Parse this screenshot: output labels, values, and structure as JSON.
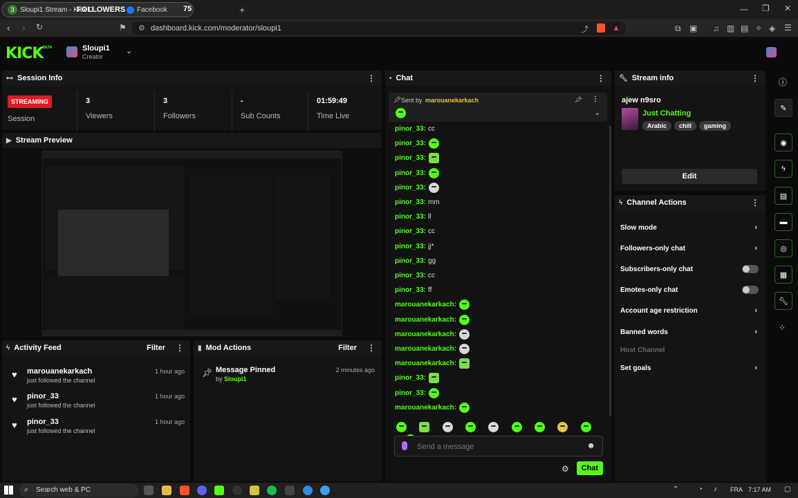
{
  "browser": {
    "tab_counter": "3",
    "tab_title": "Sloupi1 Stream - Kick D...",
    "overlay_followers": "FOLLOWERS",
    "overlay_facebook": "Facebook",
    "overlay_count": "75",
    "url": "dashboard.kick.com/moderator/sloupi1"
  },
  "header": {
    "logo": "KICK",
    "beta": "BETA",
    "channel_name": "Sloupi1",
    "channel_role": "Creator"
  },
  "session_info": {
    "title": "Session Info",
    "streaming_badge": "STREAMING",
    "session_label": "Session",
    "stats": [
      {
        "value": "3",
        "label": "Viewers"
      },
      {
        "value": "3",
        "label": "Followers"
      },
      {
        "value": "-",
        "label": "Sub Counts"
      },
      {
        "value": "01:59:49",
        "label": "Time Live"
      }
    ]
  },
  "stream_preview": {
    "title": "Stream Preview"
  },
  "activity_feed": {
    "title": "Activity Feed",
    "filter": "Filter",
    "items": [
      {
        "name": "marouanekarkach",
        "action": "just followed the channel",
        "time": "1 hour ago"
      },
      {
        "name": "pinor_33",
        "action": "just followed the channel",
        "time": "1 hour ago"
      },
      {
        "name": "pinor_33",
        "action": "just followed the channel",
        "time": "1 hour ago"
      }
    ]
  },
  "mod_actions": {
    "title": "Mod Actions",
    "filter": "Filter",
    "items": [
      {
        "title": "Message Pinned",
        "by_prefix": "by",
        "by_user": "Sloupi1",
        "time": "2 minutes ago"
      }
    ]
  },
  "chat": {
    "title": "Chat",
    "pinned_prefix": "Sent by",
    "pinned_user": "marouanekarkach",
    "messages": [
      {
        "user": "pinor_33:",
        "text": "cc",
        "emote": ""
      },
      {
        "user": "pinor_33:",
        "text": "",
        "emote": "green"
      },
      {
        "user": "pinor_33:",
        "text": "",
        "emote": "box"
      },
      {
        "user": "pinor_33:",
        "text": "",
        "emote": "green"
      },
      {
        "user": "pinor_33:",
        "text": "",
        "emote": "robot"
      },
      {
        "user": "pinor_33:",
        "text": "mm",
        "emote": ""
      },
      {
        "user": "pinor_33:",
        "text": "ll",
        "emote": ""
      },
      {
        "user": "pinor_33:",
        "text": "cc",
        "emote": ""
      },
      {
        "user": "pinor_33:",
        "text": "jj*",
        "emote": ""
      },
      {
        "user": "pinor_33:",
        "text": "gg",
        "emote": ""
      },
      {
        "user": "pinor_33:",
        "text": "cc",
        "emote": ""
      },
      {
        "user": "pinor_33:",
        "text": "ff",
        "emote": ""
      },
      {
        "user": "marouanekarkach:",
        "text": "",
        "emote": "green"
      },
      {
        "user": "marouanekarkach:",
        "text": "",
        "emote": "green"
      },
      {
        "user": "marouanekarkach:",
        "text": "",
        "emote": "robot"
      },
      {
        "user": "marouanekarkach:",
        "text": "",
        "emote": "robot"
      },
      {
        "user": "marouanekarkach:",
        "text": "",
        "emote": "box"
      },
      {
        "user": "pinor_33:",
        "text": "",
        "emote": "box"
      },
      {
        "user": "pinor_33:",
        "text": "",
        "emote": "green"
      },
      {
        "user": "marouanekarkach:",
        "text": "",
        "emote": "green"
      }
    ],
    "input_placeholder": "Send a message",
    "send_button": "Chat"
  },
  "stream_info": {
    "title": "Stream info",
    "stream_title": "ajew n9sro",
    "category": "Just Chatting",
    "tags": [
      "Arabic",
      "chill",
      "gaming"
    ],
    "edit_button": "Edit"
  },
  "channel_actions": {
    "title": "Channel Actions",
    "items": [
      {
        "label": "Slow mode",
        "control": "chevron"
      },
      {
        "label": "Followers-only chat",
        "control": "chevron"
      },
      {
        "label": "Subscribers-only chat",
        "control": "toggle"
      },
      {
        "label": "Emotes-only chat",
        "control": "toggle"
      },
      {
        "label": "Account age restriction",
        "control": "chevron"
      },
      {
        "label": "Banned words",
        "control": "chevron"
      },
      {
        "label": "Host Channel",
        "control": "disabled"
      },
      {
        "label": "Set goals",
        "control": "chevron"
      }
    ]
  },
  "taskbar": {
    "search_placeholder": "Search web & PC",
    "language": "FRA",
    "time": "7:17 AM"
  },
  "colors": {
    "accent": "#53fc18",
    "bg": "#0b0b0b",
    "panel": "#141414",
    "streaming_red": "#e01b24"
  }
}
